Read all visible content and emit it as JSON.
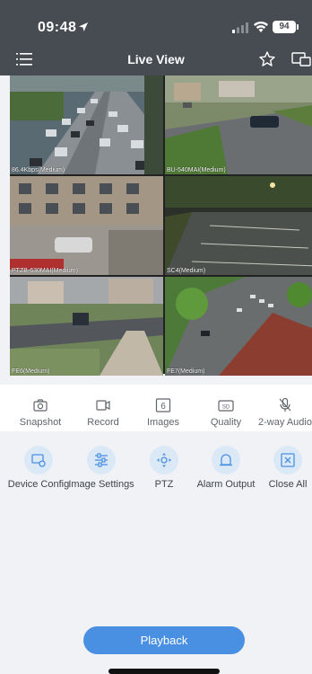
{
  "status": {
    "time": "09:48",
    "battery": "94"
  },
  "nav": {
    "title": "Live View"
  },
  "cameras": [
    {
      "label": "86.4Kbps(Medium)"
    },
    {
      "label": "BU-540MAI(Medium)"
    },
    {
      "label": "PTZB-630MAI(Medium)"
    },
    {
      "label": "SC4(Medium)"
    },
    {
      "label": "FE6(Medium)"
    },
    {
      "label": "FE7(Medium)"
    }
  ],
  "toolbar_primary": [
    {
      "label": "Snapshot",
      "icon": "camera-icon"
    },
    {
      "label": "Record",
      "icon": "video-record-icon"
    },
    {
      "label": "Images",
      "icon": "images-count-icon",
      "badge": "6"
    },
    {
      "label": "Quality",
      "icon": "quality-sd-icon",
      "badge": "SD"
    },
    {
      "label": "2-way Audio",
      "icon": "microphone-icon"
    }
  ],
  "toolbar_secondary": [
    {
      "label": "Device Config",
      "icon": "device-config-icon"
    },
    {
      "label": "Image Settings",
      "icon": "sliders-icon"
    },
    {
      "label": "PTZ",
      "icon": "ptz-icon"
    },
    {
      "label": "Alarm Output",
      "icon": "alarm-bell-icon"
    },
    {
      "label": "Close All",
      "icon": "close-all-icon"
    }
  ],
  "playback": {
    "label": "Playback"
  },
  "colors": {
    "header": "#474b52",
    "accent": "#4a90e2",
    "icon_bg": "#dbe8f6",
    "background": "#f1f2f6"
  }
}
